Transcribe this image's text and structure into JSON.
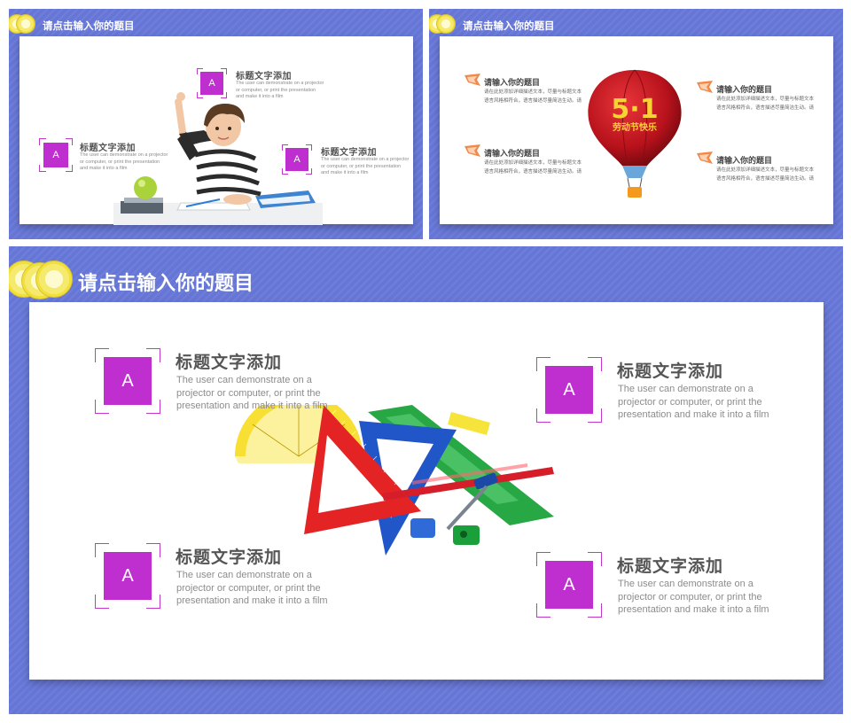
{
  "slide_main": {
    "title": "请点击输入你的题目",
    "items": [
      {
        "badge": "A",
        "heading": "标题文字添加",
        "body": "The user can demonstrate on a projector or computer, or print the presentation and make it into a film"
      },
      {
        "badge": "A",
        "heading": "标题文字添加",
        "body": "The user can demonstrate on a projector or computer, or print the presentation and make it into a film"
      },
      {
        "badge": "A",
        "heading": "标题文字添加",
        "body": "The user can demonstrate on a projector or computer, or print the presentation and make it into a film"
      },
      {
        "badge": "A",
        "heading": "标题文字添加",
        "body": "The user can demonstrate on a projector or computer, or print the presentation and make it into a film"
      }
    ]
  },
  "slide_kid": {
    "title": "请点击输入你的题目",
    "items": [
      {
        "badge": "A",
        "heading": "标题文字添加",
        "body": "The user can demonstrate on a projector or computer, or print the presentation and make it into a film"
      },
      {
        "badge": "A",
        "heading": "标题文字添加",
        "body": "The user can demonstrate on a projector or computer, or print the presentation and make it into a film"
      },
      {
        "badge": "A",
        "heading": "标题文字添加",
        "body": "The user can demonstrate on a projector or computer, or print the presentation and make it into a film"
      }
    ]
  },
  "slide_balloon": {
    "title": "请点击输入你的题目",
    "balloon_text": "劳动节快乐",
    "balloon_number": "5·1",
    "items": [
      {
        "heading": "请输入你的题目",
        "body": "请在此处添加详细描述文本，尽量与标题文本语言风格相符合，语言描述尽量简洁生动。请"
      },
      {
        "heading": "请输入你的题目",
        "body": "请在此处添加详细描述文本，尽量与标题文本语言风格相符合，语言描述尽量简洁生动。请"
      },
      {
        "heading": "请输入你的题目",
        "body": "请在此处添加详细描述文本，尽量与标题文本语言风格相符合，语言描述尽量简洁生动。请"
      },
      {
        "heading": "请输入你的题目",
        "body": "请在此处添加详细描述文本，尽量与标题文本语言风格相符合，语言描述尽量简洁生动。请"
      }
    ]
  },
  "colors": {
    "background": "#6676d6",
    "accent": "#bf2fd0",
    "heading": "#555555",
    "body": "#8c8c8c"
  }
}
